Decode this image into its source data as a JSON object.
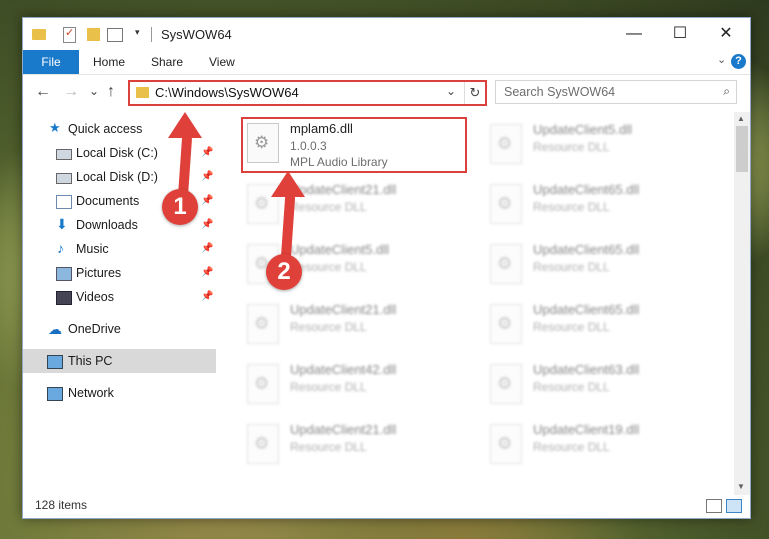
{
  "window": {
    "title": "SysWOW64",
    "controls": {
      "minimize": "—",
      "maximize": "☐",
      "close": "✕"
    }
  },
  "ribbon": {
    "tabs": [
      "File",
      "Home",
      "Share",
      "View"
    ],
    "expand_icon": "chevron-down-icon",
    "help": "?"
  },
  "navigation": {
    "back": "←",
    "forward": "→",
    "recent": "⌄",
    "up": "↑",
    "address": "C:\\Windows\\SysWOW64",
    "search_placeholder": "Search SysWOW64"
  },
  "sidebar": {
    "items": [
      {
        "label": "Quick access",
        "icon": "star-icon",
        "pinned": false
      },
      {
        "label": "Local Disk (C:)",
        "icon": "drive-icon",
        "pinned": true
      },
      {
        "label": "Local Disk (D:)",
        "icon": "drive-icon",
        "pinned": true
      },
      {
        "label": "Documents",
        "icon": "documents-icon",
        "pinned": true
      },
      {
        "label": "Downloads",
        "icon": "download-icon",
        "pinned": true
      },
      {
        "label": "Music",
        "icon": "music-icon",
        "pinned": true
      },
      {
        "label": "Pictures",
        "icon": "pictures-icon",
        "pinned": true
      },
      {
        "label": "Videos",
        "icon": "videos-icon",
        "pinned": true
      },
      {
        "label": "OneDrive",
        "icon": "cloud-icon",
        "pinned": false
      },
      {
        "label": "This PC",
        "icon": "computer-icon",
        "pinned": false,
        "selected": true
      },
      {
        "label": "Network",
        "icon": "network-icon",
        "pinned": false
      }
    ]
  },
  "files": {
    "left_column": [
      {
        "name": "mplam6.dll",
        "version": "1.0.0.3",
        "description": "MPL Audio Library",
        "highlighted": true
      },
      {
        "name": "UpdateClient21.dll",
        "description": "Resource DLL"
      },
      {
        "name": "UpdateClient5.dll",
        "description": "Resource DLL"
      },
      {
        "name": "UpdateClient21.dll",
        "description": "Resource DLL"
      },
      {
        "name": "UpdateClient42.dll",
        "description": "Resource DLL"
      },
      {
        "name": "UpdateClient21.dll",
        "description": "Resource DLL"
      }
    ],
    "right_column": [
      {
        "name": "UpdateClient5.dll",
        "description": "Resource DLL"
      },
      {
        "name": "UpdateClient65.dll",
        "description": "Resource DLL"
      },
      {
        "name": "UpdateClient65.dll",
        "description": "Resource DLL"
      },
      {
        "name": "UpdateClient65.dll",
        "description": "Resource DLL"
      },
      {
        "name": "UpdateClient63.dll",
        "description": "Resource DLL"
      },
      {
        "name": "UpdateClient19.dll",
        "description": "Resource DLL"
      }
    ]
  },
  "status": {
    "item_count": "128 items"
  },
  "annotations": {
    "step1": "1",
    "step2": "2",
    "color": "#e0403a"
  }
}
